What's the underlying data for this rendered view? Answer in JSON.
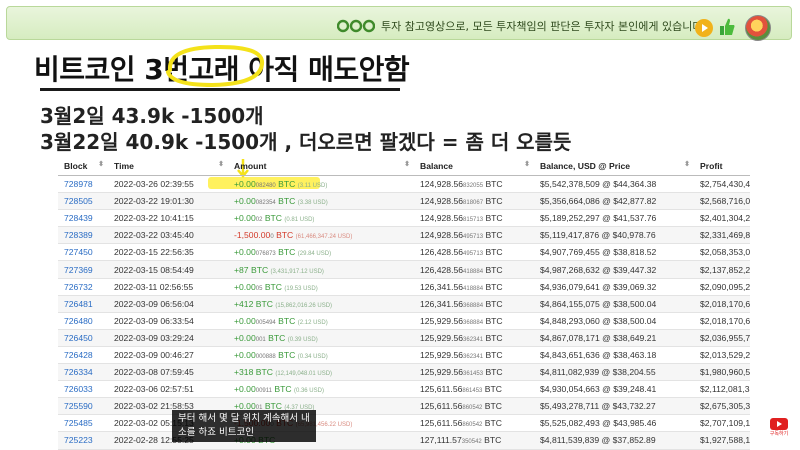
{
  "banner": {
    "text": "투자 참고영상으로, 모든 투자책임의 판단은 투자자 본인에게 있습니다",
    "bg_color": "#dcefc8"
  },
  "title": "비트코인 3번고래 아직 매도안함",
  "subtitle_lines": [
    "3월2일 43.9k -1500개",
    "3월22일 40.9k -1500개 , 더오르면 팔겠다 = 좀 더 오를듯"
  ],
  "table": {
    "headers": [
      "Block",
      "Time",
      "Amount",
      "Balance",
      "Balance, USD @ Price",
      "Profit"
    ],
    "rows": [
      {
        "block": "728978",
        "time": "2022-03-26 02:39:55",
        "amount": "+0.00",
        "amount_frac": "082480",
        "amount_unit": "BTC",
        "amount_usd": "(3.11 USD)",
        "sign": "pos",
        "balance": "124,928.56",
        "balance_frac": "832055",
        "balance_unit": "BTC",
        "usd_price": "$5,542,378,509 @ $44,364.38",
        "profit": "$2,754,430,482"
      },
      {
        "block": "728505",
        "time": "2022-03-22 19:01:30",
        "amount": "+0.00",
        "amount_frac": "082354",
        "amount_unit": "BTC",
        "amount_usd": "(3.38 USD)",
        "sign": "pos",
        "balance": "124,928.56",
        "balance_frac": "818067",
        "balance_unit": "BTC",
        "usd_price": "$5,356,664,086 @ $42,877.82",
        "profit": "$2,568,716,060"
      },
      {
        "block": "728439",
        "time": "2022-03-22 10:41:15",
        "amount": "+0.00",
        "amount_frac": "02",
        "amount_unit": "BTC",
        "amount_usd": "(0.81 USD)",
        "sign": "pos",
        "balance": "124,928.56",
        "balance_frac": "815713",
        "balance_unit": "BTC",
        "usd_price": "$5,189,252,297 @ $41,537.76",
        "profit": "$2,401,304,272"
      },
      {
        "block": "728389",
        "time": "2022-03-22 03:45:40",
        "amount": "-1,500.00",
        "amount_frac": "0",
        "amount_unit": "BTC",
        "amount_usd": "(61,466,347.24 USD)",
        "sign": "neg",
        "balance": "124,928.56",
        "balance_frac": "495713",
        "balance_unit": "BTC",
        "usd_price": "$5,119,417,876 @ $40,978.76",
        "profit": "$2,331,469,859"
      },
      {
        "block": "727450",
        "time": "2022-03-15 22:56:35",
        "amount": "+0.00",
        "amount_frac": "076873",
        "amount_unit": "BTC",
        "amount_usd": "(29.84 USD)",
        "sign": "pos",
        "balance": "126,428.56",
        "balance_frac": "495713",
        "balance_unit": "BTC",
        "usd_price": "$4,907,769,455 @ $38,818.52",
        "profit": "$2,058,353,092"
      },
      {
        "block": "727369",
        "time": "2022-03-15 08:54:49",
        "amount": "+87",
        "amount_frac": "",
        "amount_unit": "BTC",
        "amount_usd": "(3,431,917.12 USD)",
        "sign": "pos",
        "balance": "126,428.56",
        "balance_frac": "418884",
        "balance_unit": "BTC",
        "usd_price": "$4,987,268,632 @ $39,447.32",
        "profit": "$2,137,852,298"
      },
      {
        "block": "726732",
        "time": "2022-03-11 02:56:55",
        "amount": "+0.00",
        "amount_frac": "05",
        "amount_unit": "BTC",
        "amount_usd": "(19.53 USD)",
        "sign": "pos",
        "balance": "126,341.56",
        "balance_frac": "418884",
        "balance_unit": "BTC",
        "usd_price": "$4,936,079,641 @ $39,069.32",
        "profit": "$2,090,095,225"
      },
      {
        "block": "726481",
        "time": "2022-03-09 06:56:04",
        "amount": "+412",
        "amount_frac": "",
        "amount_unit": "BTC",
        "amount_usd": "(15,862,016.26 USD)",
        "sign": "pos",
        "balance": "126,341.56",
        "balance_frac": "368884",
        "balance_unit": "BTC",
        "usd_price": "$4,864,155,075 @ $38,500.04",
        "profit": "$2,018,170,678"
      },
      {
        "block": "726480",
        "time": "2022-03-09 06:33:54",
        "amount": "+0.00",
        "amount_frac": "005494",
        "amount_unit": "BTC",
        "amount_usd": "(2.12 USD)",
        "sign": "pos",
        "balance": "125,929.56",
        "balance_frac": "368884",
        "balance_unit": "BTC",
        "usd_price": "$4,848,293,060 @ $38,500.04",
        "profit": "$2,018,170,678"
      },
      {
        "block": "726450",
        "time": "2022-03-09 03:29:24",
        "amount": "+0.00",
        "amount_frac": "001",
        "amount_unit": "BTC",
        "amount_usd": "(0.39 USD)",
        "sign": "pos",
        "balance": "125,929.56",
        "balance_frac": "362341",
        "balance_unit": "BTC",
        "usd_price": "$4,867,078,171 @ $38,649.21",
        "profit": "$2,036,955,791"
      },
      {
        "block": "726428",
        "time": "2022-03-09 00:46:27",
        "amount": "+0.00",
        "amount_frac": "000888",
        "amount_unit": "BTC",
        "amount_usd": "(0.34 USD)",
        "sign": "pos",
        "balance": "125,929.56",
        "balance_frac": "362341",
        "balance_unit": "BTC",
        "usd_price": "$4,843,651,636 @ $38,463.18",
        "profit": "$2,013,529,256"
      },
      {
        "block": "726334",
        "time": "2022-03-08 07:59:45",
        "amount": "+318",
        "amount_frac": "",
        "amount_unit": "BTC",
        "amount_usd": "(12,149,048.01 USD)",
        "sign": "pos",
        "balance": "125,929.56",
        "balance_frac": "361453",
        "balance_unit": "BTC",
        "usd_price": "$4,811,082,939 @ $38,204.55",
        "profit": "$1,980,960,560"
      },
      {
        "block": "726033",
        "time": "2022-03-06 02:57:51",
        "amount": "+0.00",
        "amount_frac": "00911",
        "amount_unit": "BTC",
        "amount_usd": "(0.36 USD)",
        "sign": "pos",
        "balance": "125,611.56",
        "balance_frac": "861453",
        "balance_unit": "BTC",
        "usd_price": "$4,930,054,663 @ $39,248.41",
        "profit": "$2,112,081,332"
      },
      {
        "block": "725590",
        "time": "2022-03-02 21:58:53",
        "amount": "+0.00",
        "amount_frac": "01",
        "amount_unit": "BTC",
        "amount_usd": "(4.37 USD)",
        "sign": "pos",
        "balance": "125,611.56",
        "balance_frac": "860542",
        "balance_unit": "BTC",
        "usd_price": "$5,493,278,711 @ $43,732.27",
        "profit": "$2,675,305,380"
      },
      {
        "block": "725485",
        "time": "2022-03-02 05:15:13",
        "amount": "-1,500.00",
        "amount_frac": "0",
        "amount_unit": "BTC",
        "amount_usd": "(65,981,456.22 USD)",
        "sign": "neg",
        "balance": "125,611.56",
        "balance_frac": "860542",
        "balance_unit": "BTC",
        "usd_price": "$5,525,082,493 @ $43,985.46",
        "profit": "$2,707,109,166"
      },
      {
        "block": "725223",
        "time": "2022-02-28 12:55:25",
        "amount": "+0.00",
        "amount_frac": "",
        "amount_unit": "BTC",
        "amount_usd": "",
        "sign": "pos",
        "balance": "127,111.57",
        "balance_frac": "350542",
        "balance_unit": "BTC",
        "usd_price": "$4,811,539,839 @ $37,852.89",
        "profit": "$1,927,588,104"
      }
    ]
  },
  "caption_lines": [
    "부터 해서 몇 달 위치 계속해서 내",
    "소를 하죠 비트코인"
  ],
  "subscribe_label": "구독하기",
  "colors": {
    "link": "#2a6cc4",
    "positive": "#3a9a3a",
    "negative": "#d33a2a",
    "highlight": "#ffec28"
  }
}
